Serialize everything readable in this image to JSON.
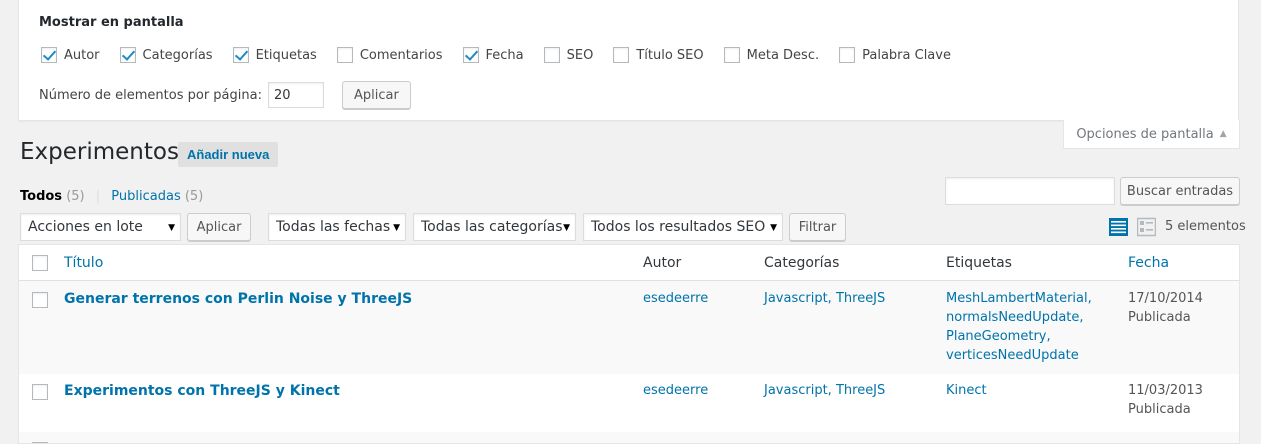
{
  "screen_options": {
    "title": "Mostrar en pantalla",
    "columns": [
      {
        "label": "Autor",
        "checked": true
      },
      {
        "label": "Categorías",
        "checked": true
      },
      {
        "label": "Etiquetas",
        "checked": true
      },
      {
        "label": "Comentarios",
        "checked": false
      },
      {
        "label": "Fecha",
        "checked": true
      },
      {
        "label": "SEO",
        "checked": false
      },
      {
        "label": "Título SEO",
        "checked": false
      },
      {
        "label": "Meta Desc.",
        "checked": false
      },
      {
        "label": "Palabra Clave",
        "checked": false
      }
    ],
    "per_page_label": "Número de elementos por página:",
    "per_page_value": "20",
    "apply_label": "Aplicar",
    "tab_label": "Opciones de pantalla"
  },
  "header": {
    "title": "Experimentos",
    "add_new": "Añadir nueva"
  },
  "filters": {
    "all_label": "Todos",
    "all_count": "(5)",
    "published_label": "Publicadas",
    "published_count": "(5)",
    "separator": "|"
  },
  "search": {
    "value": "",
    "button": "Buscar entradas"
  },
  "tablenav": {
    "bulk_actions": "Acciones en lote",
    "apply": "Aplicar",
    "dates": "Todas las fechas",
    "categories": "Todas las categorías",
    "seo": "Todos los resultados SEO",
    "filter": "Filtrar",
    "items_count": "5 elementos"
  },
  "table": {
    "columns": {
      "title": "Título",
      "author": "Autor",
      "categories": "Categorías",
      "tags": "Etiquetas",
      "date": "Fecha"
    },
    "rows": [
      {
        "title": "Generar terrenos con Perlin Noise y ThreeJS",
        "author": "esedeerre",
        "categories": "Javascript, ThreeJS",
        "tags": [
          "MeshLambertMaterial,",
          "normalsNeedUpdate,",
          "PlaneGeometry,",
          "verticesNeedUpdate"
        ],
        "date": "17/10/2014",
        "status": "Publicada"
      },
      {
        "title": "Experimentos con ThreeJS y Kinect",
        "author": "esedeerre",
        "categories": "Javascript, ThreeJS",
        "tags": [
          "Kinect"
        ],
        "date": "11/03/2013",
        "status": "Publicada"
      }
    ]
  },
  "colors": {
    "link": "#0073aa",
    "checkmark": "#1e8cbe",
    "background": "#f1f1f1"
  }
}
